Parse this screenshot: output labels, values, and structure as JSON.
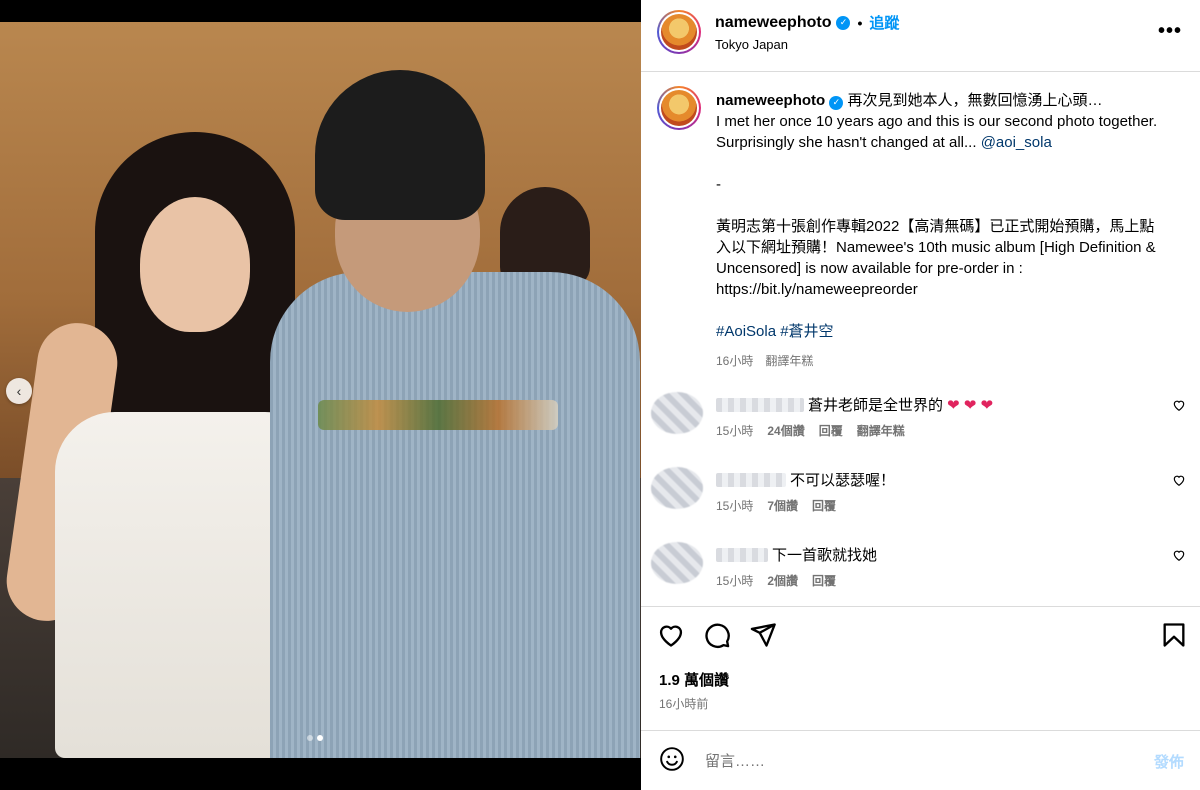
{
  "post": {
    "username": "nameweephoto",
    "follow_label": "追蹤",
    "separator": "•",
    "location": "Tokyo Japan",
    "more_label": "•••"
  },
  "caption": {
    "username": "nameweephoto",
    "line1": "再次見到她本人，無數回憶湧上心頭…",
    "line2": "I met her once 10 years ago and this is our second photo together. Surprisingly she hasn't changed at all...",
    "mention": "@aoi_sola",
    "dash": "-",
    "para2": "黃明志第十張創作專輯2022【高清無碼】已正式開始預購，馬上點入以下網址預購！Namewee's 10th music album [High Definition & Uncensored] is now available for pre-order in : https://bit.ly/nameweepreorder",
    "tag1": "#AoiSola",
    "tag2": "#蒼井空",
    "time": "16小時",
    "translate": "翻譯年糕"
  },
  "comments": [
    {
      "text": "蒼井老師是全世界的",
      "emoji": "❤ ❤ ❤",
      "time": "15小時",
      "likes": "24個讚",
      "reply": "回覆",
      "translate": "翻譯年糕"
    },
    {
      "text": "不可以瑟瑟喔！",
      "time": "15小時",
      "likes": "7個讚",
      "reply": "回覆"
    },
    {
      "text": "下一首歌就找她",
      "time": "15小時",
      "likes": "2個讚",
      "reply": "回覆"
    }
  ],
  "actions": {
    "likes": "1.9 萬個讚",
    "time": "16小時前"
  },
  "composer": {
    "placeholder": "留言……",
    "post_label": "發佈"
  }
}
